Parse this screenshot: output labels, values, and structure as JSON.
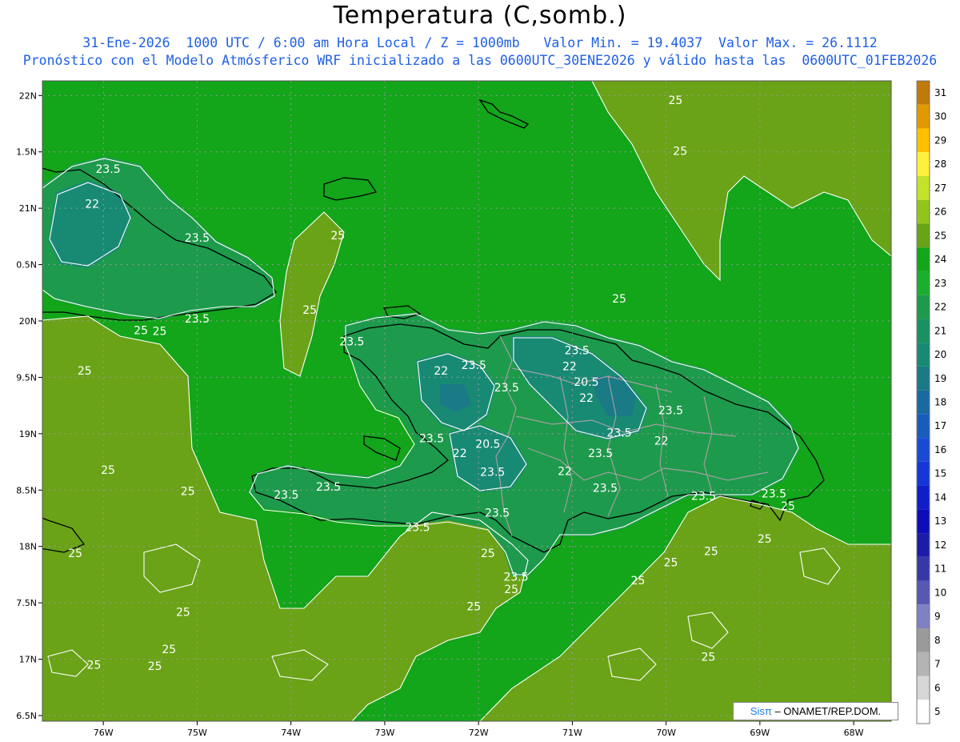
{
  "title": "Temperatura (C,somb.)",
  "subtitle_1": "31-Ene-2026  1000 UTC / 6:00 am Hora Local / Z = 1000mb   Valor Min. = 19.4037  Valor Max. = 26.1112",
  "subtitle_2": "Pronóstico con el Modelo Atmósferico WRF inicializado a las 0600UTC_30ENE2026 y válido hasta las  0600UTC_01FEB2026",
  "credit": {
    "brand": "Sisπ",
    "text": " – ONAMET/REP.DOM."
  },
  "map": {
    "lon_range": [
      -76.65,
      -67.6
    ],
    "lat_range": [
      16.45,
      22.13
    ],
    "lat_ticks": [
      {
        "value": 22,
        "label": "22N"
      },
      {
        "value": 21.5,
        "label": "1.5N"
      },
      {
        "value": 21,
        "label": "21N"
      },
      {
        "value": 20.5,
        "label": "0.5N"
      },
      {
        "value": 20,
        "label": "20N"
      },
      {
        "value": 19.5,
        "label": "9.5N"
      },
      {
        "value": 19,
        "label": "19N"
      },
      {
        "value": 18.5,
        "label": "8.5N"
      },
      {
        "value": 18,
        "label": "18N"
      },
      {
        "value": 17.5,
        "label": "7.5N"
      },
      {
        "value": 17,
        "label": "17N"
      },
      {
        "value": 16.5,
        "label": "6.5N"
      }
    ],
    "lon_ticks": [
      {
        "value": -76,
        "label": "76W"
      },
      {
        "value": -75,
        "label": "75W"
      },
      {
        "value": -74,
        "label": "74W"
      },
      {
        "value": -73,
        "label": "73W"
      },
      {
        "value": -72,
        "label": "72W"
      },
      {
        "value": -71,
        "label": "71W"
      },
      {
        "value": -70,
        "label": "70W"
      },
      {
        "value": -69,
        "label": "69W"
      },
      {
        "value": -68,
        "label": "68W"
      }
    ],
    "background_color": "#13a51a",
    "warm_color": "#6aa317",
    "cool_color": "#1e9a4c",
    "cold_color": "#188a74",
    "coldest_color": "#1a7a86",
    "contour_labels": [
      {
        "text": "25",
        "lon": -69.9,
        "lat": 21.96
      },
      {
        "text": "25",
        "lon": -69.85,
        "lat": 21.51
      },
      {
        "text": "25",
        "lon": -73.5,
        "lat": 20.76
      },
      {
        "text": "25",
        "lon": -70.5,
        "lat": 20.2
      },
      {
        "text": "25",
        "lon": -73.8,
        "lat": 20.1
      },
      {
        "text": "23.5",
        "lon": -75.95,
        "lat": 21.35
      },
      {
        "text": "22",
        "lon": -76.12,
        "lat": 21.04
      },
      {
        "text": "23.5",
        "lon": -75.0,
        "lat": 20.74
      },
      {
        "text": "23.5",
        "lon": -75.0,
        "lat": 20.02
      },
      {
        "text": "25",
        "lon": -75.6,
        "lat": 19.92
      },
      {
        "text": "25",
        "lon": -75.4,
        "lat": 19.91
      },
      {
        "text": "25",
        "lon": -76.2,
        "lat": 19.56
      },
      {
        "text": "23.5",
        "lon": -73.35,
        "lat": 19.82
      },
      {
        "text": "22",
        "lon": -72.4,
        "lat": 19.56
      },
      {
        "text": "23.5",
        "lon": -72.05,
        "lat": 19.61
      },
      {
        "text": "23.5",
        "lon": -71.7,
        "lat": 19.41
      },
      {
        "text": "23.5",
        "lon": -70.95,
        "lat": 19.74
      },
      {
        "text": "22",
        "lon": -71.03,
        "lat": 19.6
      },
      {
        "text": "20.5",
        "lon": -70.85,
        "lat": 19.46
      },
      {
        "text": "22",
        "lon": -70.85,
        "lat": 19.32
      },
      {
        "text": "23.5",
        "lon": -69.95,
        "lat": 19.21
      },
      {
        "text": "23.5",
        "lon": -72.5,
        "lat": 18.96
      },
      {
        "text": "20.5",
        "lon": -71.9,
        "lat": 18.91
      },
      {
        "text": "22",
        "lon": -72.2,
        "lat": 18.83
      },
      {
        "text": "23.5",
        "lon": -71.85,
        "lat": 18.66
      },
      {
        "text": "22",
        "lon": -71.08,
        "lat": 18.67
      },
      {
        "text": "23.5",
        "lon": -70.5,
        "lat": 19.01
      },
      {
        "text": "23.5",
        "lon": -70.7,
        "lat": 18.83
      },
      {
        "text": "22",
        "lon": -70.05,
        "lat": 18.94
      },
      {
        "text": "23.5",
        "lon": -70.65,
        "lat": 18.52
      },
      {
        "text": "23.5",
        "lon": -73.6,
        "lat": 18.53
      },
      {
        "text": "23.5",
        "lon": -74.05,
        "lat": 18.46
      },
      {
        "text": "23.5",
        "lon": -71.8,
        "lat": 18.3
      },
      {
        "text": "23.5",
        "lon": -72.65,
        "lat": 18.17
      },
      {
        "text": "23.5",
        "lon": -69.6,
        "lat": 18.45
      },
      {
        "text": "23.5",
        "lon": -68.85,
        "lat": 18.47
      },
      {
        "text": "25",
        "lon": -68.7,
        "lat": 18.36
      },
      {
        "text": "25",
        "lon": -75.95,
        "lat": 18.68
      },
      {
        "text": "25",
        "lon": -75.1,
        "lat": 18.49
      },
      {
        "text": "25",
        "lon": -68.95,
        "lat": 18.07
      },
      {
        "text": "25",
        "lon": -76.3,
        "lat": 17.94
      },
      {
        "text": "25",
        "lon": -71.9,
        "lat": 17.94
      },
      {
        "text": "25",
        "lon": -69.52,
        "lat": 17.96
      },
      {
        "text": "25",
        "lon": -69.95,
        "lat": 17.86
      },
      {
        "text": "25",
        "lon": -70.3,
        "lat": 17.7
      },
      {
        "text": "23.5",
        "lon": -71.6,
        "lat": 17.73
      },
      {
        "text": "25",
        "lon": -71.65,
        "lat": 17.62
      },
      {
        "text": "25",
        "lon": -72.05,
        "lat": 17.47
      },
      {
        "text": "25",
        "lon": -75.15,
        "lat": 17.42
      },
      {
        "text": "25",
        "lon": -75.3,
        "lat": 17.09
      },
      {
        "text": "25",
        "lon": -76.1,
        "lat": 16.95
      },
      {
        "text": "25",
        "lon": -75.45,
        "lat": 16.94
      },
      {
        "text": "25",
        "lon": -69.55,
        "lat": 17.02
      }
    ]
  },
  "colorbar": {
    "levels": [
      {
        "label": "31",
        "color": "#c07a0c"
      },
      {
        "label": "30",
        "color": "#e09a00"
      },
      {
        "label": "29",
        "color": "#ffc000"
      },
      {
        "label": "28",
        "color": "#fff03c"
      },
      {
        "label": "27",
        "color": "#c3e32a"
      },
      {
        "label": "26",
        "color": "#92c51c"
      },
      {
        "label": "25",
        "color": "#6aa317"
      },
      {
        "label": "24",
        "color": "#13a51a"
      },
      {
        "label": "23",
        "color": "#1bae2e"
      },
      {
        "label": "22",
        "color": "#1e9a4c"
      },
      {
        "label": "21",
        "color": "#1a9160"
      },
      {
        "label": "20",
        "color": "#188a74"
      },
      {
        "label": "19",
        "color": "#1a7a86"
      },
      {
        "label": "18",
        "color": "#1a6aa0"
      },
      {
        "label": "17",
        "color": "#1a5cbc"
      },
      {
        "label": "16",
        "color": "#1a4ad4"
      },
      {
        "label": "15",
        "color": "#1636d8"
      },
      {
        "label": "14",
        "color": "#0f1ec8"
      },
      {
        "label": "13",
        "color": "#0c0cb8"
      },
      {
        "label": "12",
        "color": "#1c1ca8"
      },
      {
        "label": "11",
        "color": "#3838a8"
      },
      {
        "label": "10",
        "color": "#5858b4"
      },
      {
        "label": "9",
        "color": "#8080c4"
      },
      {
        "label": "8",
        "color": "#9a9a9a"
      },
      {
        "label": "7",
        "color": "#b4b4b4"
      },
      {
        "label": "6",
        "color": "#d6d6d6"
      },
      {
        "label": "5",
        "color": "#ffffff"
      }
    ]
  }
}
